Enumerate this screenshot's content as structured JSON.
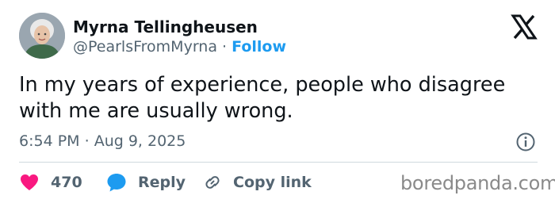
{
  "author": {
    "name": "Myrna Tellingheusen",
    "handle": "@PearlsFromMyrna",
    "separator": "·",
    "follow_label": "Follow"
  },
  "tweet": {
    "text": "In my years of experience, people who disagree with me are usually wrong.",
    "time": "6:54 PM",
    "date_separator": "·",
    "date": "Aug 9, 2025"
  },
  "actions": {
    "like_count": "470",
    "reply_label": "Reply",
    "copy_label": "Copy link"
  },
  "watermark": "boredpanda.com",
  "icons": {
    "platform": "x-logo-icon",
    "info": "info-icon",
    "like": "heart-icon",
    "reply": "speech-bubble-icon",
    "copy": "link-icon"
  },
  "colors": {
    "text": "#0f1419",
    "muted": "#536471",
    "accent": "#1d9bf0",
    "like": "#f91880",
    "divider": "#cfd9de",
    "watermark": "#8a8a8a"
  }
}
